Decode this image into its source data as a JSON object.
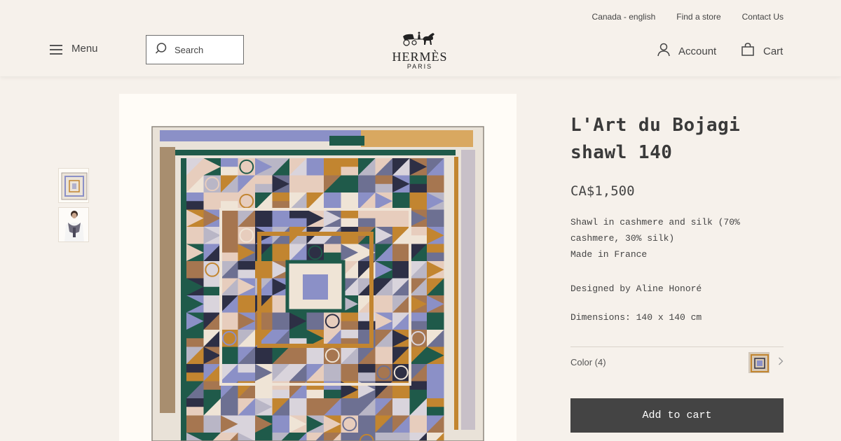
{
  "header": {
    "utility_links": [
      "Canada - english",
      "Find a store",
      "Contact Us"
    ],
    "menu_label": "Menu",
    "search_placeholder": "Search",
    "logo_brand": "HERMÈS",
    "logo_city": "PARIS",
    "account_label": "Account",
    "cart_label": "Cart"
  },
  "icons": {
    "menu": "hamburger-icon",
    "search": "search-icon",
    "logo": "horse-carriage-logo",
    "account": "person-icon",
    "cart": "shopping-bag-icon",
    "color_chevron": "chevron-right-icon"
  },
  "gallery": {
    "thumbnails": [
      "scarf-flat-thumbnail",
      "scarf-worn-thumbnail"
    ]
  },
  "product": {
    "title": "L'Art du Bojagi shawl 140",
    "price": "CA$1,500",
    "description_lines": [
      "Shawl in cashmere and silk (70%",
      "cashmere, 30% silk)",
      "Made in France"
    ],
    "designer": "Designed by Aline Honoré",
    "dimensions": "Dimensions: 140 x 140 cm",
    "color_label": "Color (4)",
    "add_to_cart_label": "Add to cart"
  },
  "colors": {
    "background": "#f6f1eb",
    "button": "#444444",
    "scarf_blue": "#8b90c7",
    "scarf_orange": "#c28530",
    "scarf_green": "#1f5a4a",
    "scarf_navy": "#2d2f45"
  }
}
